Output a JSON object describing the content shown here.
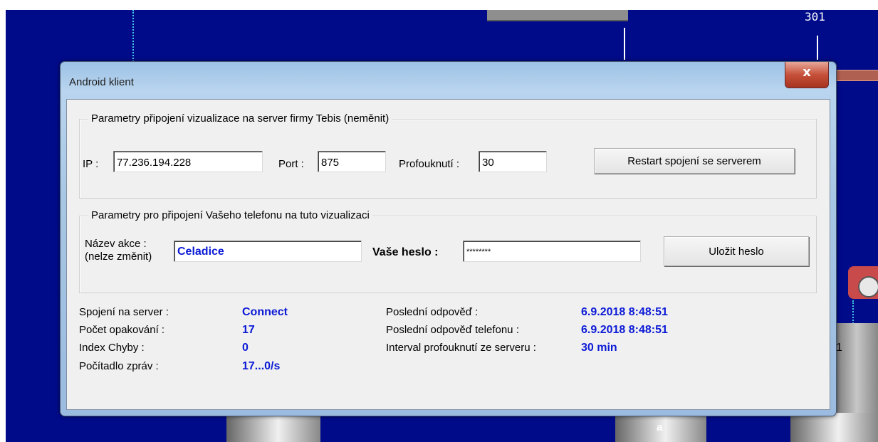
{
  "background": {
    "number_label": "301",
    "letter_label": "a",
    "side_digit": "1"
  },
  "dialog": {
    "title": "Android klient",
    "close_label": "x",
    "server_group": {
      "legend": "Parametry připojení vizualizace na server firmy Tebis  (neměnit)",
      "ip_label": "IP :",
      "ip_value": "77.236.194.228",
      "port_label": "Port :",
      "port_value": "875",
      "blow_label": "Profouknutí :",
      "blow_value": "30",
      "restart_button": "Restart spojení se serverem"
    },
    "phone_group": {
      "legend": "Parametry pro připojení Vašeho telefonu na tuto vizualizaci",
      "action_label_line1": "Název akce :",
      "action_label_line2": "(nelze změnit)",
      "action_value": "Celadice",
      "password_label": "Vaše heslo :",
      "password_value": "********",
      "save_button": "Uložit heslo"
    },
    "status": {
      "left": [
        {
          "label": "Spojení na server :",
          "value": "Connect"
        },
        {
          "label": "Počet opakování :",
          "value": "17"
        },
        {
          "label": "Index Chyby :",
          "value": "0"
        },
        {
          "label": "Počítadlo zpráv :",
          "value": "17...0/s"
        }
      ],
      "right": [
        {
          "label": "Poslední odpověď  :",
          "value": "6.9.2018  8:48:51"
        },
        {
          "label": "Poslední odpověď telefonu :",
          "value": "6.9.2018  8:48:51"
        },
        {
          "label": "Interval profouknutí ze serveru :",
          "value": "30 min"
        }
      ]
    }
  },
  "colors": {
    "background": "#000b8a",
    "value_text": "#0b1ad6",
    "pipe_gray": "#a8a8a8"
  }
}
